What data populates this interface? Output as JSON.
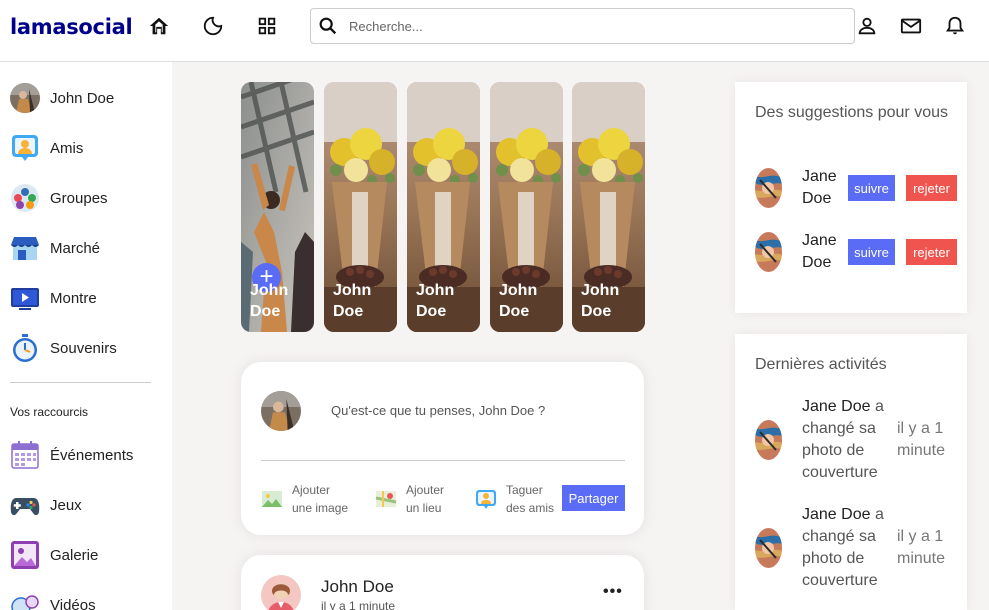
{
  "navbar": {
    "logo": "lamasocial",
    "search_placeholder": "Recherche...",
    "icons": [
      "home-icon",
      "moon-icon",
      "grid-icon",
      "search-icon",
      "person-icon",
      "mail-icon",
      "bell-icon"
    ]
  },
  "sidebar": {
    "items": [
      {
        "label": "John Doe",
        "icon": "avatar"
      },
      {
        "label": "Amis",
        "icon": "friends-icon"
      },
      {
        "label": "Groupes",
        "icon": "groups-icon"
      },
      {
        "label": "Marché",
        "icon": "market-icon"
      },
      {
        "label": "Montre",
        "icon": "watch-icon"
      },
      {
        "label": "Souvenirs",
        "icon": "stopwatch-icon"
      }
    ],
    "shortcuts_title": "Vos raccourcis",
    "shortcuts": [
      {
        "label": "Événements",
        "icon": "calendar-icon"
      },
      {
        "label": "Jeux",
        "icon": "gamepad-icon"
      },
      {
        "label": "Galerie",
        "icon": "gallery-icon"
      },
      {
        "label": "Vidéos",
        "icon": "videos-icon"
      }
    ]
  },
  "stories": [
    {
      "name": "John Doe",
      "add": true
    },
    {
      "name": "John Doe"
    },
    {
      "name": "John Doe"
    },
    {
      "name": "John Doe"
    },
    {
      "name": "John Doe"
    }
  ],
  "share": {
    "prompt": "Qu'est-ce que tu penses, John Doe ?",
    "options": [
      {
        "line1": "Ajouter",
        "line2": "une image",
        "icon": "image-icon"
      },
      {
        "line1": "Ajouter",
        "line2": "un lieu",
        "icon": "map-icon"
      },
      {
        "line1": "Taguer",
        "line2": "des amis",
        "icon": "tag-friends-icon"
      }
    ],
    "button": "Partager"
  },
  "post": {
    "author": "John Doe",
    "time": "il y a 1 minute",
    "more": "•••"
  },
  "suggestions": {
    "title": "Des suggestions pour vous",
    "items": [
      {
        "first": "Jane",
        "last": "Doe",
        "follow": "suivre",
        "reject": "rejeter"
      },
      {
        "first": "Jane",
        "last": "Doe",
        "follow": "suivre",
        "reject": "rejeter"
      }
    ]
  },
  "activities": {
    "title": "Dernières activités",
    "items": [
      {
        "name": "Jane Doe",
        "action": "a changé sa photo de couverture",
        "time": "il y a 1 minute"
      },
      {
        "name": "Jane Doe",
        "action": "a changé sa photo de couverture",
        "time": "il y a 1 minute"
      }
    ]
  },
  "colors": {
    "logo": "#00008b",
    "primary": "#5a6bf5",
    "danger": "#f0544f",
    "background": "#f6f3f3"
  }
}
